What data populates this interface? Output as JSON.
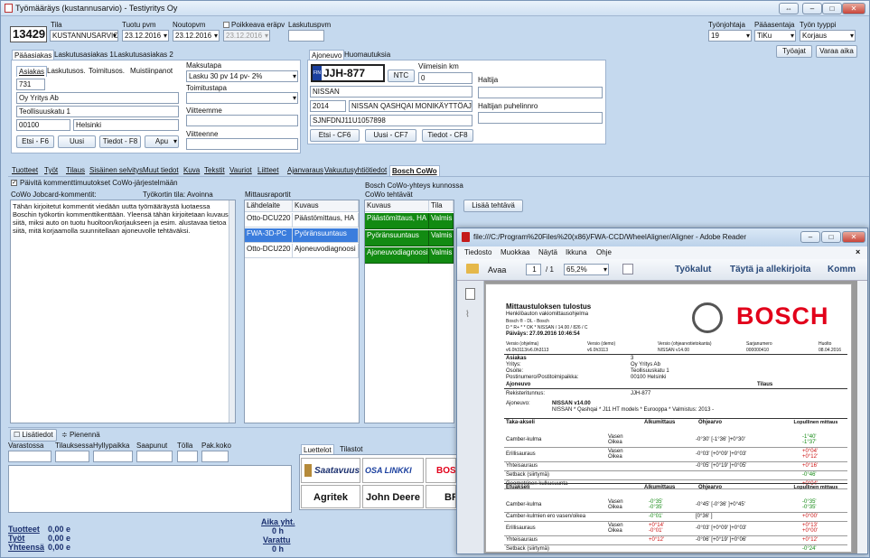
{
  "window": {
    "title": "Työmääräys (kustannusarvio) - Testiyritys Oy"
  },
  "header": {
    "order_no": "13429",
    "tila_label": "Tila",
    "tila_value": "KUSTANNUSARVIO",
    "tuotu_label": "Tuotu pvm",
    "tuotu_value": "23.12.2016",
    "nouto_label": "Noutopvm",
    "nouto_value": "23.12.2016",
    "poikkeava_label": "Poikkeava eräpv",
    "poikkeava_value": "23.12.2016",
    "laskutus_label": "Laskutuspvm",
    "tyonjohtaja_label": "Työnjohtaja",
    "tyonjohtaja_value": "19",
    "paaasentaja_label": "Pääasentaja",
    "paaasentaja_value": "TiKu",
    "tyontyyppi_label": "Työn tyyppi",
    "tyontyyppi_value": "Korjaus",
    "tyoajat_button": "Työajat",
    "varaa_button": "Varaa aika"
  },
  "customer": {
    "tabs": [
      "Pääasiakas",
      "Laskutusasiakas 1",
      "Laskutusasiakas 2"
    ],
    "subtabs": [
      "Asiakas",
      "Laskutusos.",
      "Toimitusos.",
      "Muistiinpanot"
    ],
    "number": "731",
    "name": "Oy Yritys Ab",
    "street": "Teollisuuskatu 1",
    "zip": "00100",
    "city": "Helsinki",
    "buttons": [
      "Etsi - F6",
      "Uusi",
      "Tiedot - F8",
      "Apu"
    ],
    "maksutapa_label": "Maksutapa",
    "maksutapa_value": "Lasku 30 pv 14 pv- 2%",
    "toimitustapa_label": "Toimitustapa",
    "viitteemme_label": "Viitteemme",
    "viitteenne_label": "Viitteenne"
  },
  "vehicle": {
    "tabs": [
      "Ajoneuvo",
      "Huomautuksia"
    ],
    "plate": "JJH-877",
    "plate_prefix": "FIN",
    "ntc_button": "NTC",
    "km_label": "Viimeisin km",
    "km_value": "0",
    "make": "NISSAN",
    "year": "2014",
    "model": "NISSAN QASHQAI MONIKÄYTTÖAJONEUV",
    "vin": "SJNFDNJ11U1057898",
    "haltija_label": "Haltija",
    "haltija_phone_label": "Haltijan puhelinnro",
    "buttons": [
      "Etsi - CF6",
      "Uusi - CF7",
      "Tiedot - CF8"
    ]
  },
  "main_tabs": [
    "Tuotteet",
    "Työt",
    "Tilaus",
    "Sisäinen selvitys",
    "Muut tiedot",
    "Kuva",
    "Tekstit",
    "Vauriot",
    "Liitteet",
    "Ajanvaraus",
    "Vakuutusyhtiötiedot",
    "Bosch CoWo"
  ],
  "cowo": {
    "checkbox_label": "Päivitä kommenttimuutokset CoWo-järjestelmään",
    "comment_label": "CoWo Jobcard-kommentit:",
    "status_label": "Työkortin tila: Avoinna",
    "comment_text": "Tähän kirjoitetut kommentit viedään uutta työmääräystä luotaessa Boschin työkortin kommenttikenttään. Yleensä tähän kirjoitetaan kuvaus siitä, miksi auto on tuotu huoltoon/korjaukseen ja esim. alustavaa tietoa siitä, mitä korjaamolla suunnitellaan ajoneuvolle tehtäväksi.",
    "reports_label": "Mittausraportit",
    "reports_headers": [
      "Lähdelaite",
      "Kuvaus"
    ],
    "reports": [
      [
        "Otto-DCU220",
        "Päästömittaus, HA"
      ],
      [
        "FWA-3D-PC",
        "Pyöränsuuntaus"
      ],
      [
        "Otto-DCU220",
        "Ajoneuvodiagnoosi"
      ]
    ],
    "conn_label": "Bosch CoWo-yhteys kunnossa",
    "tasks_label": "CoWo tehtävät",
    "tasks_headers": [
      "Kuvaus",
      "Tila"
    ],
    "tasks": [
      [
        "Päästömittaus, HA",
        "Valmis"
      ],
      [
        "Pyöränsuuntaus",
        "Valmis"
      ],
      [
        "Ajoneuvodiagnoosi",
        "Valmis"
      ]
    ],
    "add_task_button": "Lisää tehtävä"
  },
  "bottom": {
    "lisatiedot": "Lisätiedot",
    "pienenna": "Pienennä",
    "cols": [
      "Varastossa",
      "Tilauksessa",
      "Hyllypaikka",
      "Saapunut",
      "Tölla",
      "Pak.koko"
    ],
    "lists_tabs": [
      "Luettelot",
      "Tilastot"
    ],
    "logos": [
      "Saatavuus",
      "OSA LINKKI",
      "BOSCH",
      "Agritek",
      "John Deere",
      "BR"
    ],
    "tuotteet_label": "Tuotteet",
    "tuotteet_value": "0,00 e",
    "tyot_label": "Työt",
    "tyot_value": "0,00 e",
    "yhteensa_label": "Yhteensä",
    "yhteensa_value": "0,00 e",
    "aika_label": "Aika yht.",
    "aika_value": "0 h",
    "varattu_label": "Varattu",
    "varattu_value": "0 h"
  },
  "adobe": {
    "title": "file:///C:/Program%20Files%20(x86)/FWA-CCD/WheelAligner/Aligner - Adobe Reader",
    "menu": [
      "Tiedosto",
      "Muokkaa",
      "Näytä",
      "Ikkuna",
      "Ohje"
    ],
    "open_button": "Avaa",
    "page_current": "1",
    "page_total": "/ 1",
    "zoom": "65,2%",
    "toolbar_links": [
      "Työkalut",
      "Täytä ja allekirjoita",
      "Komm"
    ],
    "doc": {
      "title": "Mittaustuloksen tulostus",
      "subtitle": "Henkilöauton vakiomittausohjelma",
      "line1": "Bosch ® - DL - Bosch",
      "line2": "D * R+ * * OK * NISSAN / 14.00 / 826 / C",
      "date": "Päiväys: 27.09.2016 10:46:54",
      "brand": "BOSCH",
      "ver_headers": [
        "Versio (ohjelma)",
        "Versio (demo)",
        "Versio (ohjearvotietokanta)",
        "Sarjanumero",
        "Huolto"
      ],
      "ver_values": [
        "v6.0h3113/v6.0h3113",
        "v6.0h3113",
        "NISSAN v14.00",
        "000000410",
        "08.04.2016"
      ],
      "asiakas_label": "Asiakas",
      "asiakas_no": "3",
      "yritys_label": "Yritys:",
      "yritys": "Oy Yritys Ab",
      "osoite_label": "Osoite:",
      "osoite": "Teollisuuskatu 1",
      "posti_label": "Postinumero/Postitoimipaikka:",
      "posti": "00100 Helsinki",
      "ajoneuvo_label": "Ajoneuvo",
      "tilaus_label": "Tilaus",
      "rek_label": "Rekisteritunnus:",
      "rek": "JJH-877",
      "ajon_label": "Ajoneuvo:",
      "ajon": "NISSAN v14.00",
      "ajon_desc": "NISSAN * Qashqai * J11 HT models * Eurooppa * Valmistus: 2013 -",
      "rear_headers": [
        "Taka-akseli",
        "Alkumittaus",
        "Ohjearvo",
        "Lopullinen mittaus"
      ],
      "rear_rows": [
        {
          "name": "Camber-kulma",
          "sides": "Vasen\nOikea",
          "alku": "",
          "ohje": "-0°30' [-1°36' ]+0°30'",
          "lop": "-1°40'\n-1°37'"
        },
        {
          "name": "Erillisauraus",
          "sides": "Vasen\nOikea",
          "alku": "",
          "ohje": "-0°03' [+0°09' ]+0°03'",
          "lop": "+0°04'\n+0°12'"
        },
        {
          "name": "Yhteisauraus",
          "sides": "",
          "alku": "",
          "ohje": "-0°05' [+0°19' ]+0°05'",
          "lop": "+0°16'"
        },
        {
          "name": "Setback (siirtymä)",
          "sides": "",
          "alku": "",
          "ohje": "",
          "lop": "-0°46'"
        },
        {
          "name": "Geometrinen kulkusuunta",
          "sides": "",
          "alku": "",
          "ohje": "",
          "lop": "+0°04'"
        }
      ],
      "front_headers": [
        "Etuakseli",
        "Alkumittaus",
        "Ohjearvo",
        "Lopullinen mittaus"
      ],
      "front_rows": [
        {
          "name": "Camber-kulma",
          "sides": "Vasen\nOikea",
          "alku": "-0°35'\n-0°35'",
          "ohje": "-0°45' [-0°36' ]+0°45'",
          "lop": "-0°35'\n-0°35'"
        },
        {
          "name": "Camber-kulmien ero vasen/oikea",
          "sides": "",
          "alku": "-0°01'",
          "ohje": "[0°36' ]",
          "lop": "+0°00'"
        },
        {
          "name": "Erillisauraus",
          "sides": "Vasen\nOikea",
          "alku": "+0°14'\n-0°01'",
          "ohje": "-0°03' [+0°09' ]+0°03'",
          "lop": "+0°13'\n+0°00'"
        },
        {
          "name": "Yhteisauraus",
          "sides": "",
          "alku": "+0°12'",
          "ohje": "-0°06' [+0°19' ]+0°06'",
          "lop": "+0°12'"
        },
        {
          "name": "Setback (siirtymä)",
          "sides": "",
          "alku": "",
          "ohje": "",
          "lop": "-0°24'"
        }
      ]
    }
  },
  "colors": {
    "cowo_green": "#128a12",
    "selected_blue": "#3b7ddd",
    "bosch_red": "#e2001a",
    "accent_blue": "#1a3f9e"
  }
}
